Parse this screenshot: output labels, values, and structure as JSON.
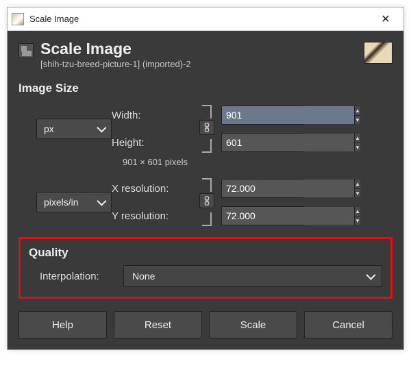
{
  "window": {
    "title": "Scale Image"
  },
  "header": {
    "title": "Scale Image",
    "subtitle": "[shih-tzu-breed-picture-1] (imported)-2"
  },
  "image_size": {
    "heading": "Image Size",
    "width_label": "Width:",
    "width_value": "901",
    "height_label": "Height:",
    "height_value": "601",
    "dim_note": "901 × 601 pixels",
    "size_unit": "px",
    "x_res_label": "X resolution:",
    "x_res_value": "72.000",
    "y_res_label": "Y resolution:",
    "y_res_value": "72.000",
    "res_unit": "pixels/in"
  },
  "quality": {
    "heading": "Quality",
    "interp_label": "Interpolation:",
    "interp_value": "None"
  },
  "footer": {
    "help": "Help",
    "reset": "Reset",
    "scale": "Scale",
    "cancel": "Cancel"
  }
}
